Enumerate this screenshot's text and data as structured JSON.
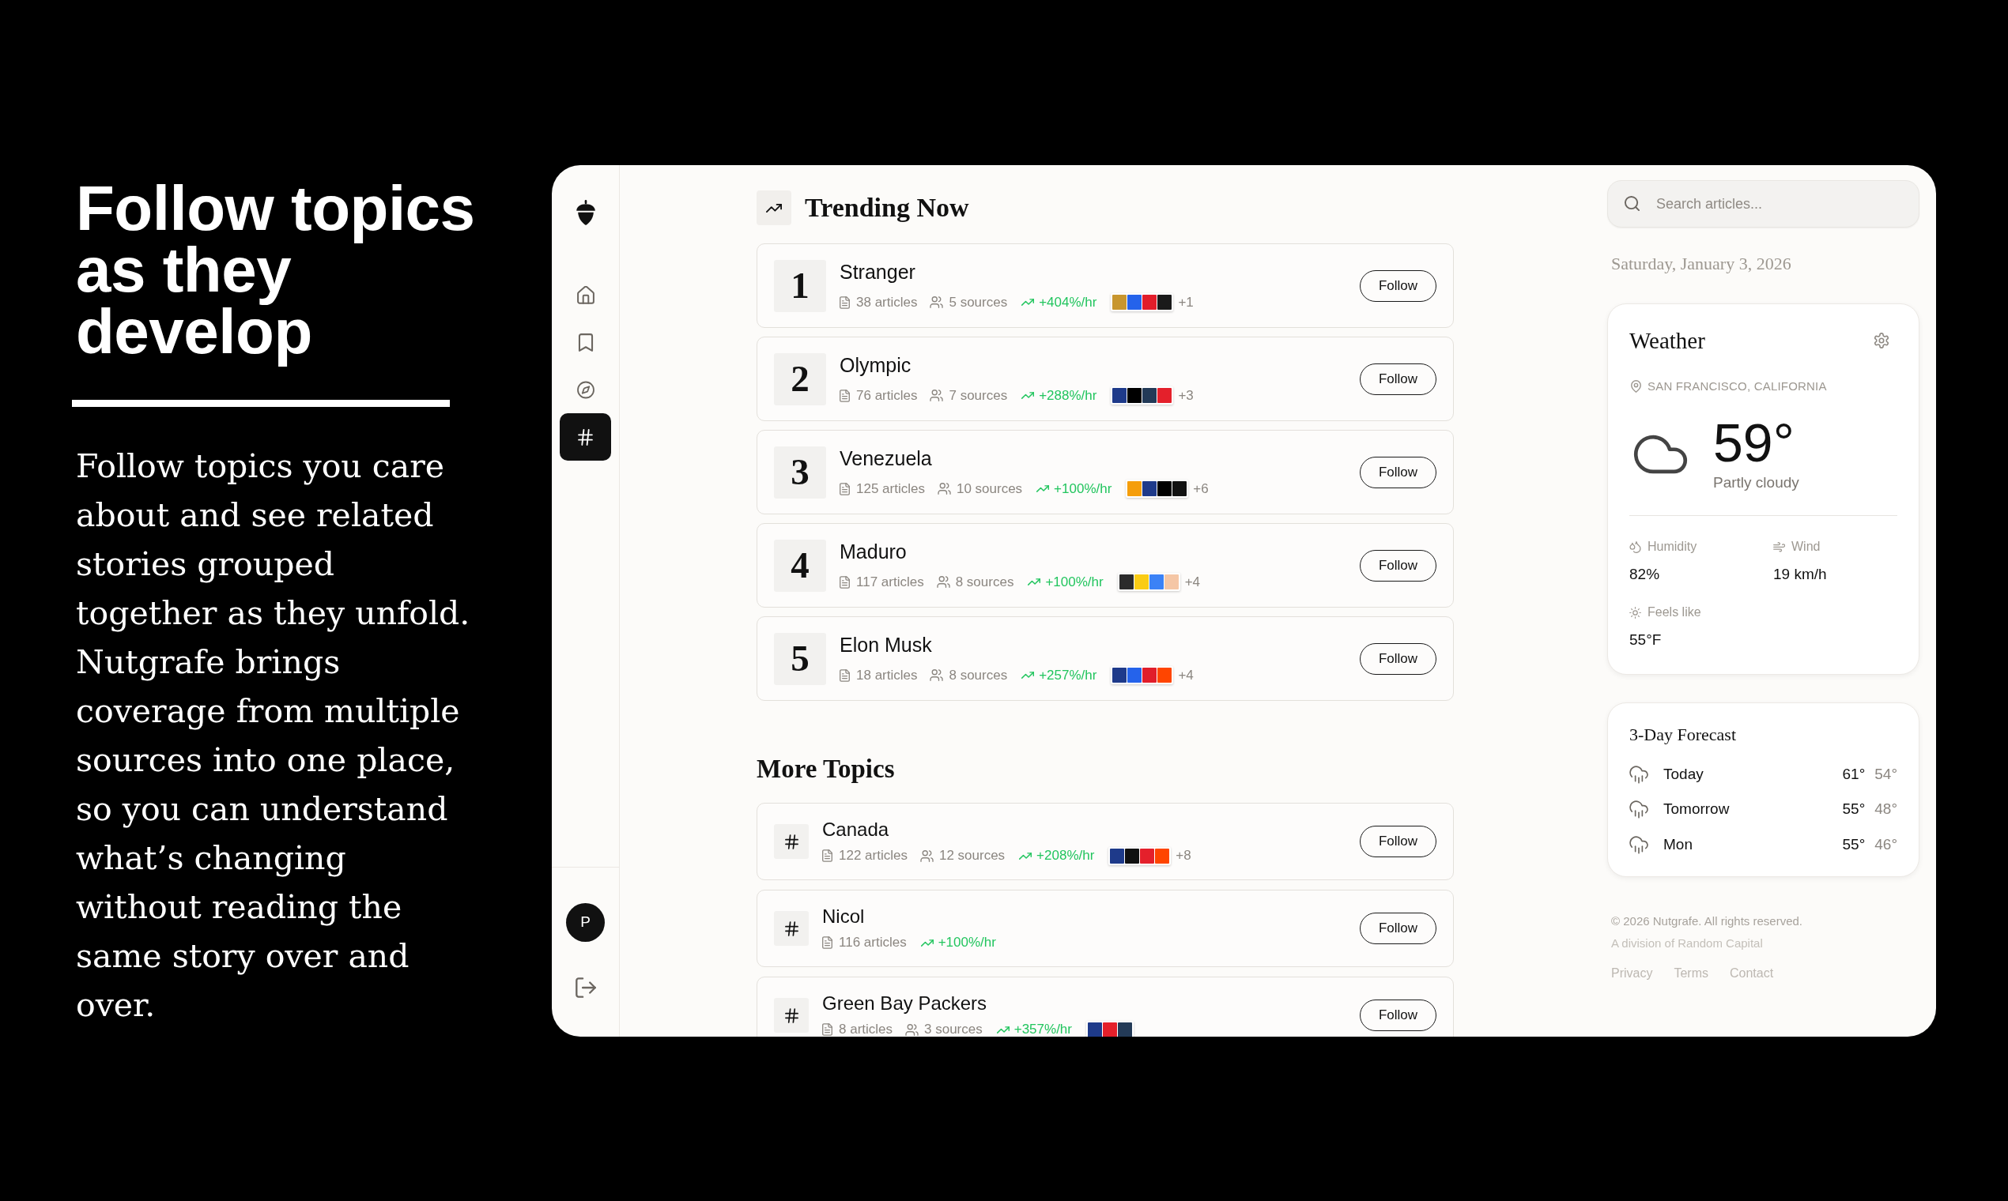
{
  "intro": {
    "heading": "Follow topics as they develop",
    "body": "Follow topics you care about and see related stories grouped together as they unfold. Nutgrafe brings coverage from multiple sources into one place, so you can understand what’s changing without reading the same story over and over."
  },
  "sidebar": {
    "items": [
      {
        "kind": "home",
        "selected": false
      },
      {
        "kind": "bookmark",
        "selected": false
      },
      {
        "kind": "compass",
        "selected": false
      },
      {
        "kind": "hash",
        "selected": true
      }
    ],
    "avatar": "P"
  },
  "trending": {
    "title": "Trending Now",
    "topics": [
      {
        "rank": "1",
        "name": "Stranger",
        "articles": "38 articles",
        "sources": "5 sources",
        "trend": "+404%/hr",
        "logos": [
          {
            "color": "#c8962e"
          },
          {
            "color": "#2563eb"
          },
          {
            "color": "#e11d2a"
          },
          {
            "color": "#1a1a1a"
          }
        ],
        "more": "+1",
        "button": "Follow"
      },
      {
        "rank": "2",
        "name": "Olympic",
        "articles": "76 articles",
        "sources": "7 sources",
        "trend": "+288%/hr",
        "logos": [
          {
            "color": "#1e3a8a"
          },
          {
            "color": "#000000"
          },
          {
            "color": "#233a57"
          },
          {
            "color": "#e4202b"
          }
        ],
        "more": "+3",
        "button": "Follow"
      },
      {
        "rank": "3",
        "name": "Venezuela",
        "articles": "125 articles",
        "sources": "10 sources",
        "trend": "+100%/hr",
        "logos": [
          {
            "color": "#f59e0b"
          },
          {
            "color": "#1e3a8a"
          },
          {
            "color": "#000000"
          },
          {
            "color": "#111111"
          }
        ],
        "more": "+6",
        "button": "Follow"
      },
      {
        "rank": "4",
        "name": "Maduro",
        "articles": "117 articles",
        "sources": "8 sources",
        "trend": "+100%/hr",
        "logos": [
          {
            "color": "#2b2b2b"
          },
          {
            "color": "#facc15"
          },
          {
            "color": "#3b82f6"
          },
          {
            "color": "#f5c6a5"
          }
        ],
        "more": "+4",
        "button": "Follow"
      },
      {
        "rank": "5",
        "name": "Elon Musk",
        "articles": "18 articles",
        "sources": "8 sources",
        "trend": "+257%/hr",
        "logos": [
          {
            "color": "#1e3a8a"
          },
          {
            "color": "#2563eb"
          },
          {
            "color": "#e11d2a"
          },
          {
            "color": "#ff4500"
          }
        ],
        "more": "+4",
        "button": "Follow"
      }
    ]
  },
  "more_topics": {
    "title": "More Topics",
    "topics": [
      {
        "name": "Canada",
        "articles": "122 articles",
        "sources": "12 sources",
        "trend": "+208%/hr",
        "logos": [
          {
            "color": "#1e3a8a"
          },
          {
            "color": "#111111"
          },
          {
            "color": "#e4202b"
          },
          {
            "color": "#ff4500"
          }
        ],
        "more": "+8",
        "button": "Follow"
      },
      {
        "name": "Nicol",
        "articles": "116 articles",
        "trend": "+100%/hr",
        "button": "Follow"
      },
      {
        "name": "Green Bay Packers",
        "articles": "8 articles",
        "sources": "3 sources",
        "trend": "+357%/hr",
        "logos": [
          {
            "color": "#1e3a8a"
          },
          {
            "color": "#e4202b"
          },
          {
            "color": "#233a57"
          }
        ],
        "button": "Follow"
      }
    ]
  },
  "search": {
    "placeholder": "Search articles..."
  },
  "date": "Saturday, January 3, 2026",
  "weather": {
    "title": "Weather",
    "location": "SAN FRANCISCO, CALIFORNIA",
    "temperature": "59°",
    "condition": "Partly cloudy",
    "stats": [
      {
        "kind": "humidity",
        "label": "Humidity",
        "value": "82%"
      },
      {
        "kind": "wind",
        "label": "Wind",
        "value": "19 km/h"
      },
      {
        "kind": "feels_like",
        "label": "Feels like",
        "value": "55°F"
      }
    ]
  },
  "forecast": {
    "title": "3-Day Forecast",
    "days": [
      {
        "day": "Today",
        "high": "61°",
        "low": "54°"
      },
      {
        "day": "Tomorrow",
        "high": "55°",
        "low": "48°"
      },
      {
        "day": "Mon",
        "high": "55°",
        "low": "46°"
      }
    ]
  },
  "footer": {
    "copyright": "© 2026 Nutgrafe. All rights reserved.",
    "division": "A division of Random Capital",
    "links": [
      "Privacy",
      "Terms",
      "Contact"
    ]
  }
}
